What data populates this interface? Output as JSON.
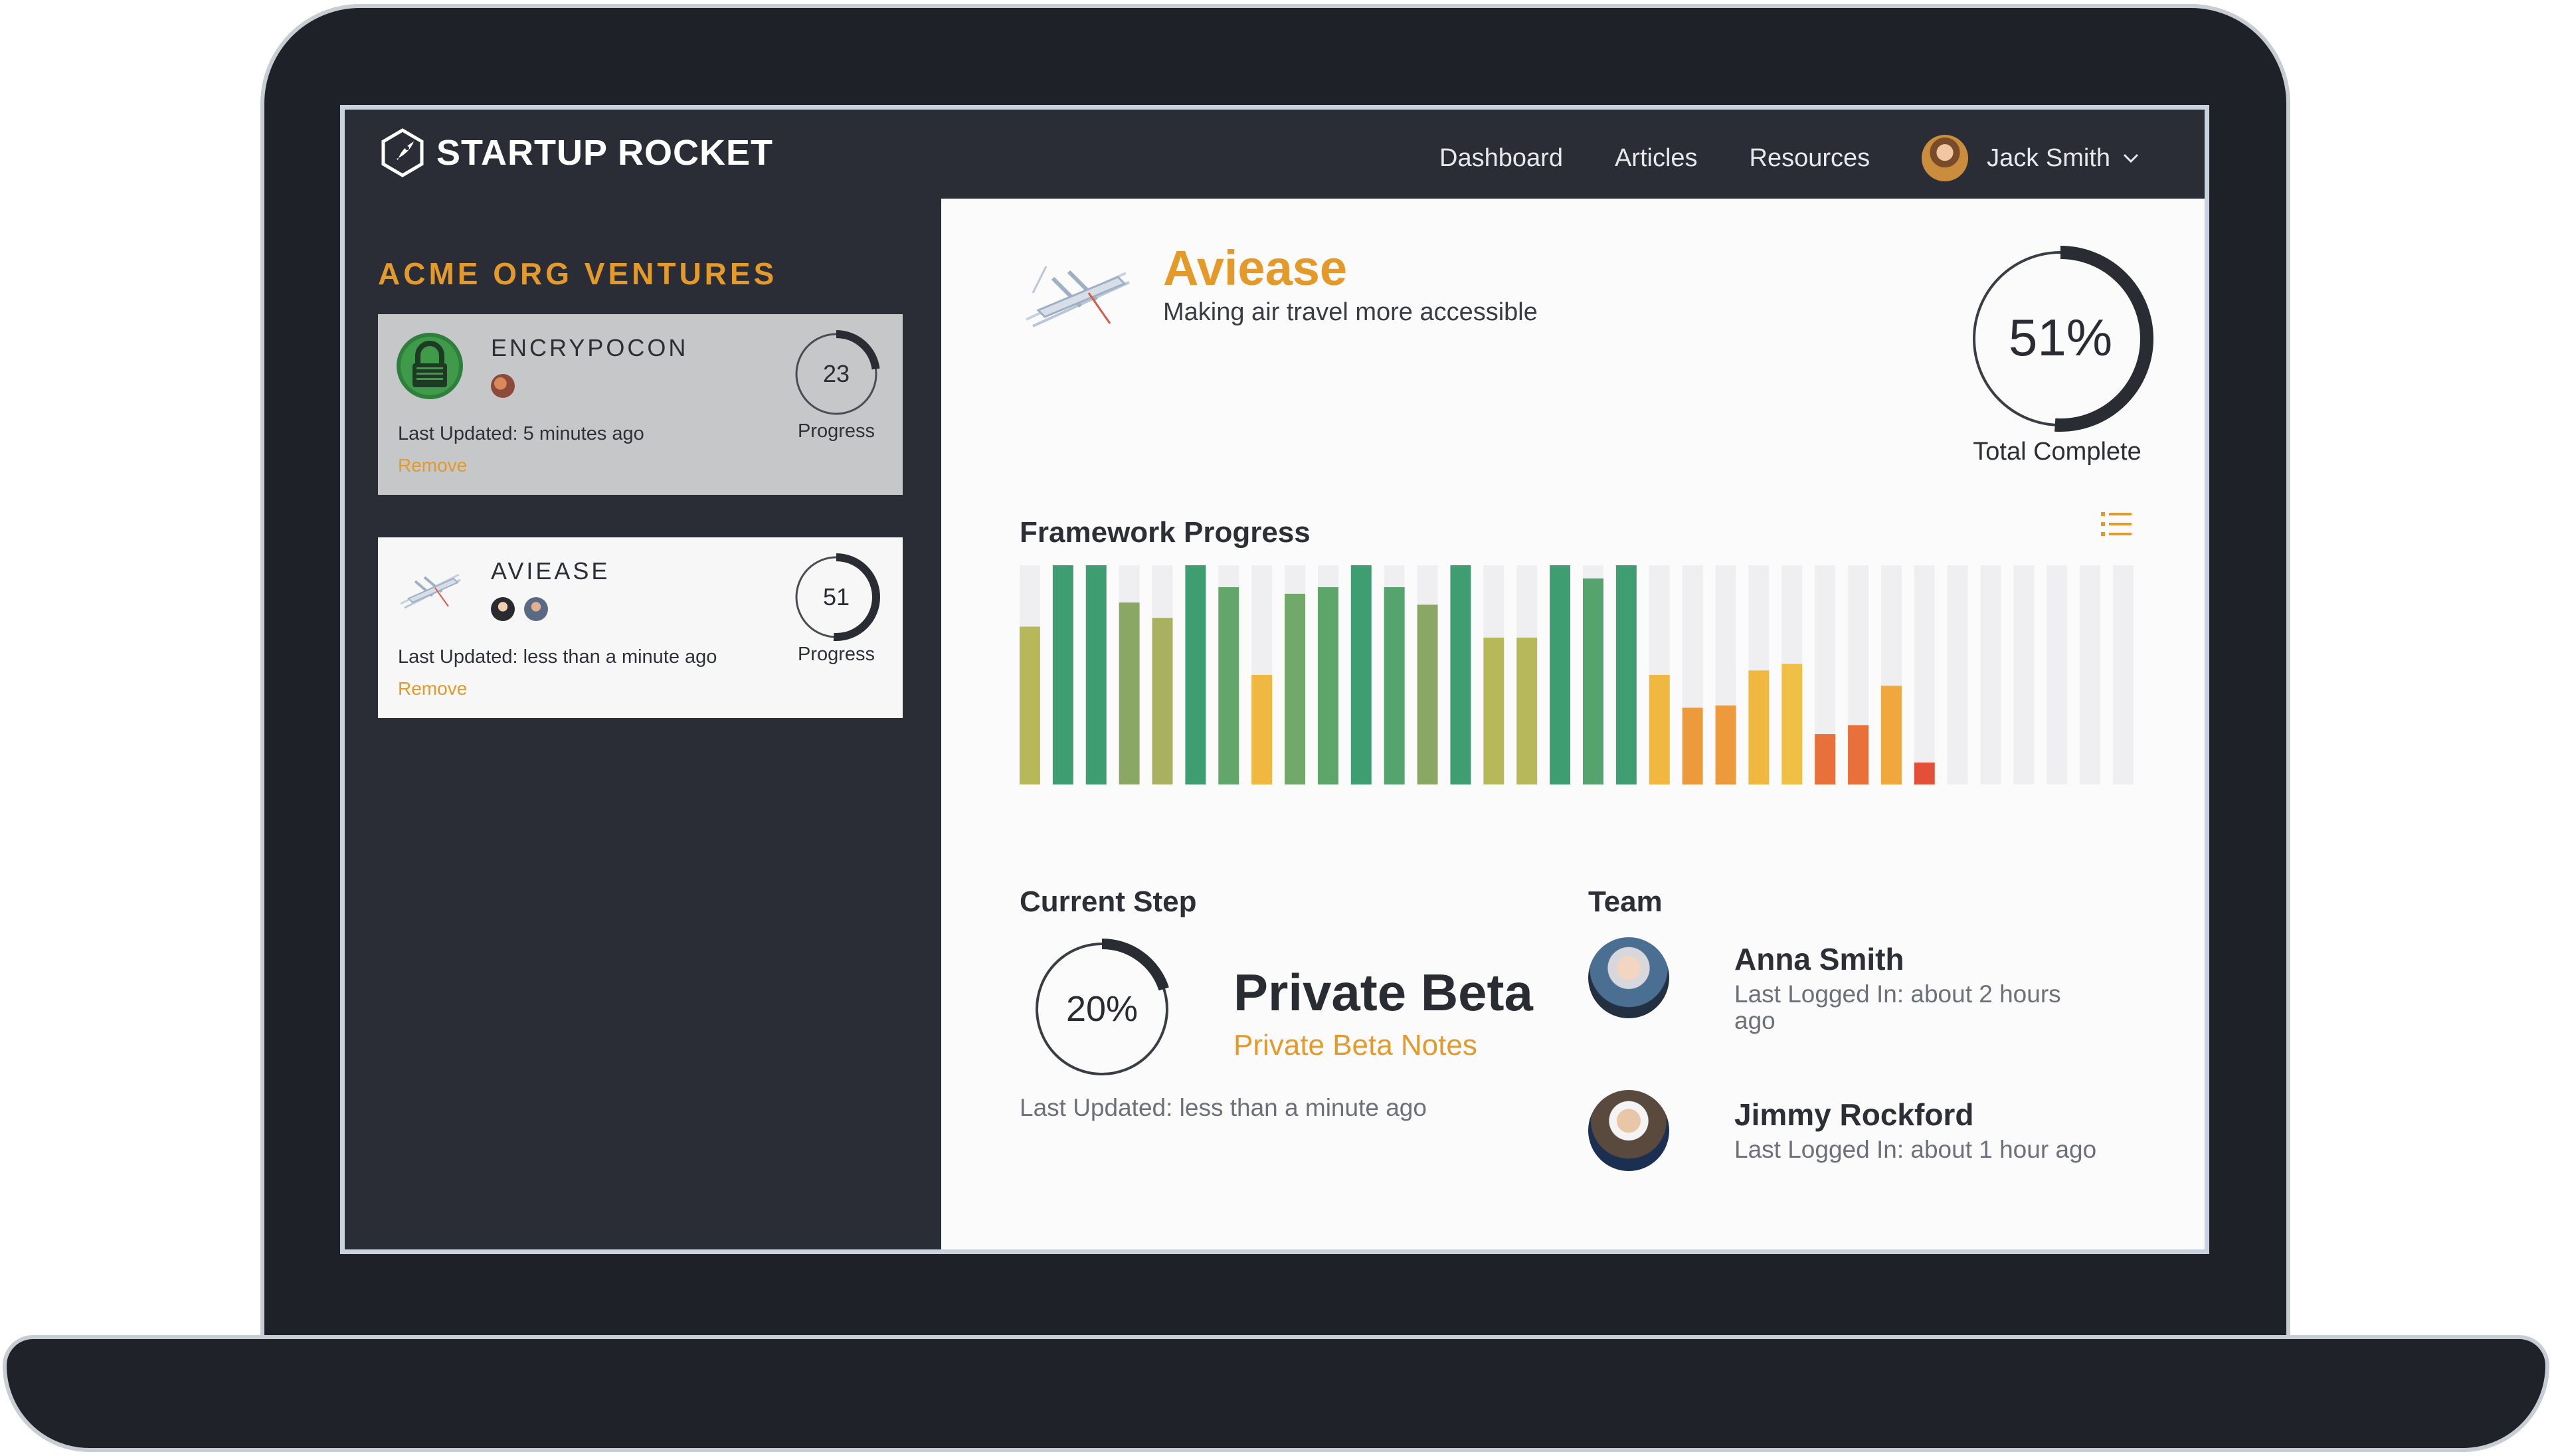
{
  "nav": {
    "brand": "STARTUP ROCKET",
    "links": [
      "Dashboard",
      "Articles",
      "Resources"
    ],
    "user_name": "Jack Smith"
  },
  "sidebar": {
    "org_title": "ACME ORG VENTURES",
    "cards": [
      {
        "name": "ENCRYPOCON",
        "progress": 23,
        "progress_label": "Progress",
        "updated": "Last Updated: 5 minutes ago",
        "remove": "Remove"
      },
      {
        "name": "AVIEASE",
        "progress": 51,
        "progress_label": "Progress",
        "updated": "Last Updated: less than a minute ago",
        "remove": "Remove"
      }
    ]
  },
  "venture": {
    "name": "Aviease",
    "tagline": "Making air travel more accessible",
    "total_percent": 51,
    "total_text": "51%",
    "total_label": "Total Complete"
  },
  "framework": {
    "title": "Framework Progress",
    "levels": [
      0.72,
      1.0,
      1.0,
      0.83,
      0.76,
      1.0,
      0.9,
      0.5,
      0.87,
      0.9,
      1.0,
      0.9,
      0.82,
      1.0,
      0.67,
      0.67,
      1.0,
      0.94,
      1.0,
      0.5,
      0.35,
      0.36,
      0.52,
      0.55,
      0.23,
      0.27,
      0.45,
      0.1,
      0,
      0,
      0,
      0,
      0,
      0
    ],
    "colors": [
      "#b6b85a",
      "#3e9e72",
      "#3e9e72",
      "#8aa864",
      "#a9b160",
      "#3e9e72",
      "#63a66c",
      "#f0b840",
      "#72a86a",
      "#5ea56c",
      "#3e9e72",
      "#55a46e",
      "#8aa864",
      "#3e9e72",
      "#b6b85a",
      "#b6b85a",
      "#3e9e72",
      "#55a46e",
      "#3e9e72",
      "#f0b840",
      "#ec9a3c",
      "#ec9a3c",
      "#f0b840",
      "#f0c046",
      "#e8703a",
      "#e8703a",
      "#f0a83e",
      "#e2503a",
      "#efeff1",
      "#efeff1",
      "#efeff1",
      "#efeff1",
      "#efeff1",
      "#efeff1"
    ],
    "track_color": "#efeff1"
  },
  "current_step": {
    "title": "Current Step",
    "percent": 20,
    "percent_text": "20%",
    "step_name": "Private Beta",
    "notes_link": "Private Beta Notes",
    "updated": "Last Updated: less than a minute ago"
  },
  "team": {
    "title": "Team",
    "members": [
      {
        "name": "Anna Smith",
        "last_seen": "Last Logged In: about 2 hours ago"
      },
      {
        "name": "Jimmy Rockford",
        "last_seen": "Last Logged In: about 1 hour ago"
      }
    ]
  },
  "colors": {
    "accent": "#e49a2b",
    "dark": "#2a2d36",
    "ring": "#2a2c33"
  }
}
